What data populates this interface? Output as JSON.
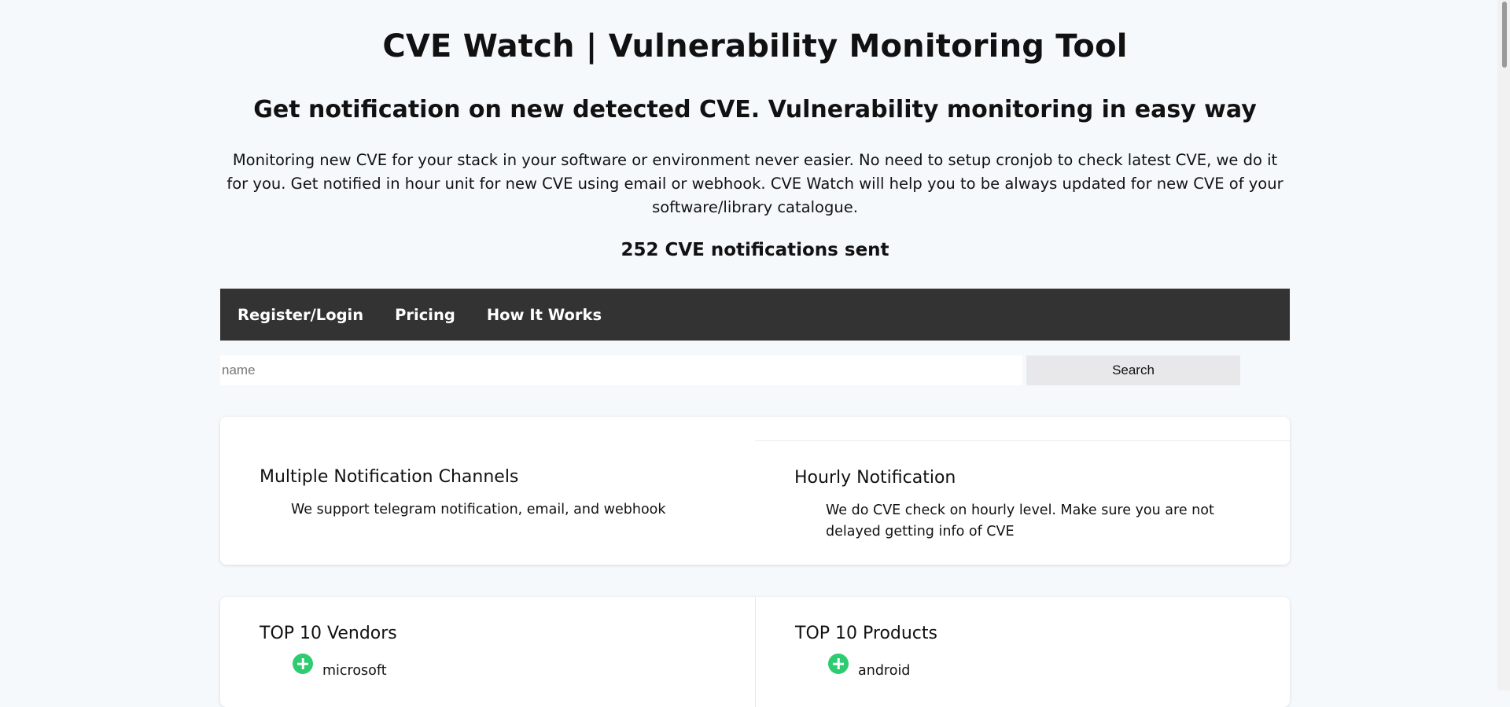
{
  "page": {
    "title": "CVE Watch | Vulnerability Monitoring Tool",
    "subtitle": "Get notification on new detected CVE. Vulnerability monitoring in easy way",
    "intro": "Monitoring new CVE for your stack in your software or environment never easier. No need to setup cronjob to check latest CVE, we do it for you. Get notified in hour unit for new CVE using email or webhook. CVE Watch will help you to be always updated for new CVE of your software/library catalogue.",
    "stats": "252 CVE notifications sent"
  },
  "nav": {
    "items": [
      {
        "label": "Register/Login"
      },
      {
        "label": "Pricing"
      },
      {
        "label": "How It Works"
      }
    ]
  },
  "search": {
    "placeholder": "name",
    "value": "",
    "button_label": "Search"
  },
  "features": [
    {
      "title": "Multiple Notification Channels",
      "text": "We support telegram notification, email, and webhook"
    },
    {
      "title": "Hourly Notification",
      "text": "We do CVE check on hourly level. Make sure you are not delayed getting info of CVE"
    }
  ],
  "top10": {
    "vendors": {
      "title": "TOP 10 Vendors",
      "items": [
        "microsoft"
      ]
    },
    "products": {
      "title": "TOP 10 Products",
      "items": [
        "android"
      ]
    }
  },
  "icons": {
    "add": "plus-circle-icon"
  },
  "colors": {
    "nav_background": "#333333",
    "add_icon": "#2ecc71",
    "page_background": "#f5f9fc"
  }
}
